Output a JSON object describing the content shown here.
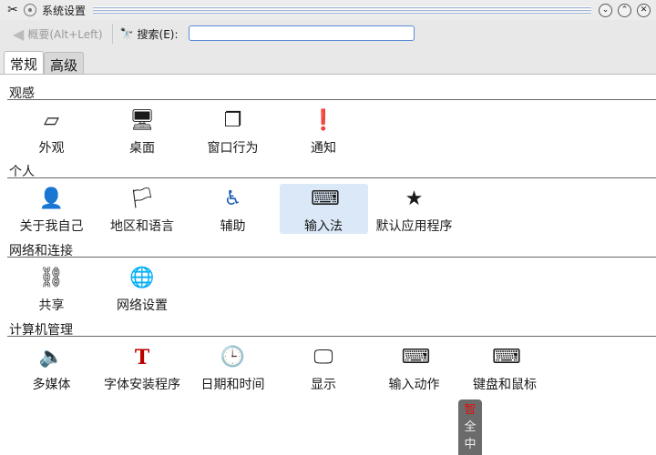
{
  "window": {
    "title": "系统设置"
  },
  "toolbar": {
    "back_label": "概要(Alt+Left)",
    "search_label": "搜索(E):",
    "search_value": ""
  },
  "tabs": [
    {
      "label": "常规"
    },
    {
      "label": "高级"
    }
  ],
  "sections": [
    {
      "title": "观感",
      "items": [
        {
          "label": "外观",
          "icon": "appearance-icon"
        },
        {
          "label": "桌面",
          "icon": "desktop-icon"
        },
        {
          "label": "窗口行为",
          "icon": "window-behavior-icon"
        },
        {
          "label": "通知",
          "icon": "notification-icon"
        }
      ]
    },
    {
      "title": "个人",
      "items": [
        {
          "label": "关于我自己",
          "icon": "user-icon"
        },
        {
          "label": "地区和语言",
          "icon": "flag-icon"
        },
        {
          "label": "辅助",
          "icon": "accessibility-icon"
        },
        {
          "label": "输入法",
          "icon": "keyboard-icon"
        },
        {
          "label": "默认应用程序",
          "icon": "default-apps-icon"
        }
      ]
    },
    {
      "title": "网络和连接",
      "items": [
        {
          "label": "共享",
          "icon": "sharing-icon"
        },
        {
          "label": "网络设置",
          "icon": "network-icon"
        }
      ]
    },
    {
      "title": "计算机管理",
      "items": [
        {
          "label": "多媒体",
          "icon": "speaker-icon"
        },
        {
          "label": "字体安装程序",
          "icon": "font-icon"
        },
        {
          "label": "日期和时间",
          "icon": "clock-icon"
        },
        {
          "label": "显示",
          "icon": "monitor-icon"
        },
        {
          "label": "输入动作",
          "icon": "input-actions-icon"
        },
        {
          "label": "键盘和鼠标",
          "icon": "keyboard-mouse-icon"
        }
      ]
    }
  ],
  "ime": {
    "chars": [
      "智",
      "全",
      "中"
    ]
  },
  "colors": {
    "selected": "#dbe8f7",
    "accent": "#5a8ad6"
  }
}
